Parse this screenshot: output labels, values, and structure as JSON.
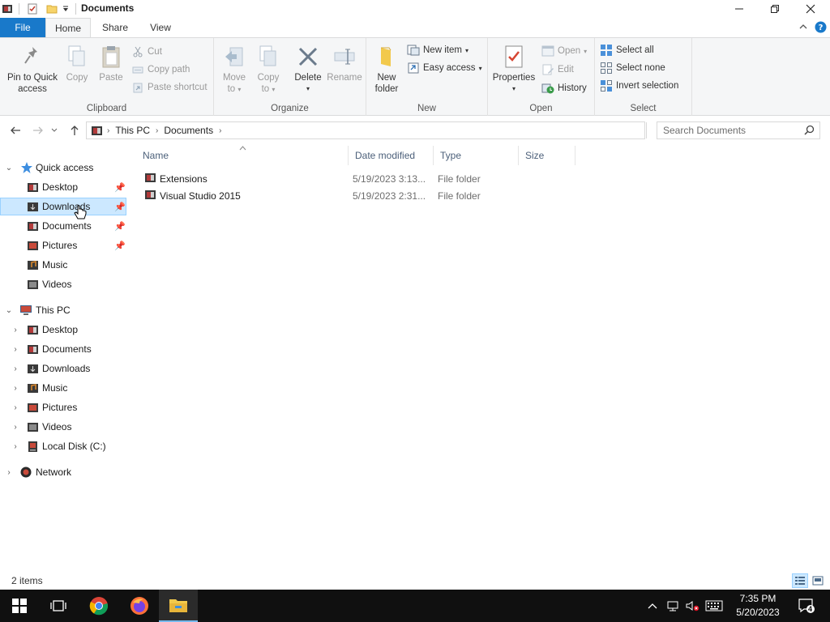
{
  "window": {
    "title": "Documents"
  },
  "ribbon_tabs": {
    "file": "File",
    "home": "Home",
    "share": "Share",
    "view": "View"
  },
  "ribbon": {
    "clipboard": {
      "label": "Clipboard",
      "pin_line1": "Pin to Quick",
      "pin_line2": "access",
      "copy": "Copy",
      "paste": "Paste",
      "cut": "Cut",
      "copy_path": "Copy path",
      "paste_shortcut": "Paste shortcut"
    },
    "organize": {
      "label": "Organize",
      "move_line1": "Move",
      "move_line2": "to",
      "copy_line1": "Copy",
      "copy_line2": "to",
      "delete": "Delete",
      "rename": "Rename"
    },
    "new": {
      "label": "New",
      "new_folder_line1": "New",
      "new_folder_line2": "folder",
      "new_item": "New item",
      "easy_access": "Easy access"
    },
    "open": {
      "label": "Open",
      "properties": "Properties",
      "open": "Open",
      "edit": "Edit",
      "history": "History"
    },
    "select": {
      "label": "Select",
      "select_all": "Select all",
      "select_none": "Select none",
      "invert_selection": "Invert selection"
    }
  },
  "address": {
    "crumbs": [
      "This PC",
      "Documents"
    ],
    "search_placeholder": "Search Documents"
  },
  "navpane": {
    "quick_access": "Quick access",
    "quick_items": [
      "Desktop",
      "Downloads",
      "Documents",
      "Pictures",
      "Music",
      "Videos"
    ],
    "this_pc": "This PC",
    "pc_items": [
      "Desktop",
      "Documents",
      "Downloads",
      "Music",
      "Pictures",
      "Videos",
      "Local Disk (C:)"
    ],
    "network": "Network"
  },
  "filelist": {
    "columns": [
      "Name",
      "Date modified",
      "Type",
      "Size"
    ],
    "rows": [
      {
        "name": "Extensions",
        "date": "5/19/2023 3:13...",
        "type": "File folder",
        "size": ""
      },
      {
        "name": "Visual Studio 2015",
        "date": "5/19/2023 2:31...",
        "type": "File folder",
        "size": ""
      }
    ]
  },
  "status": {
    "count": "2 items"
  },
  "taskbar": {
    "time": "7:35 PM",
    "date": "5/20/2023",
    "notification_count": "4"
  },
  "colors": {
    "accent": "#1979ca",
    "selection": "#cce8ff",
    "taskbar": "#101010"
  }
}
